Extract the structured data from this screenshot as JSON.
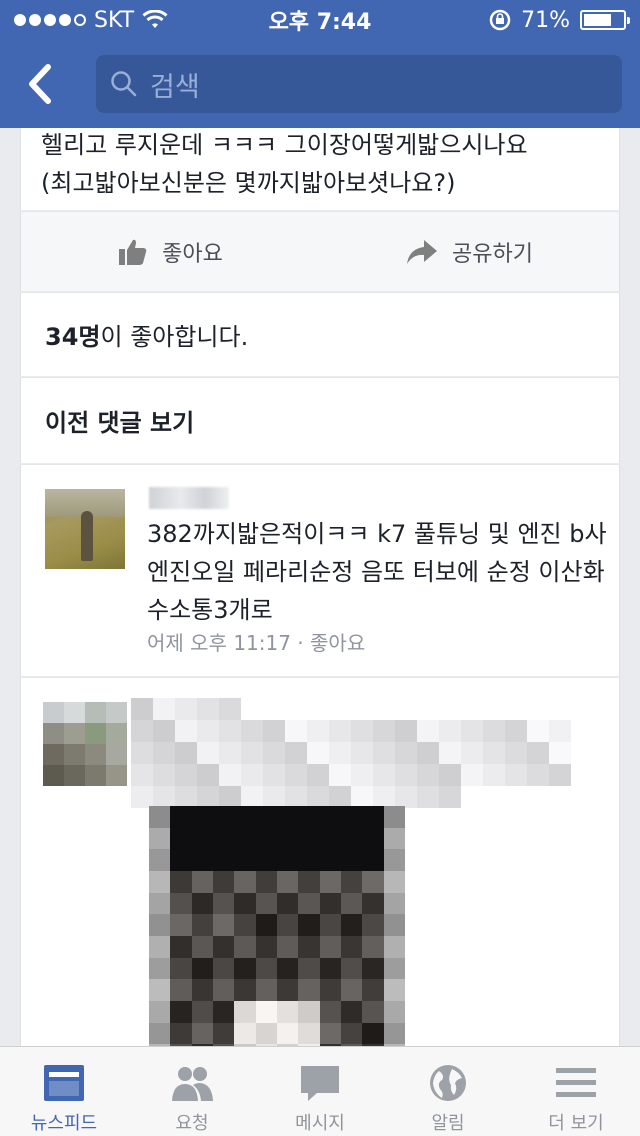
{
  "status_bar": {
    "carrier": "SKT",
    "time": "오후 7:44",
    "battery": "71%"
  },
  "search": {
    "placeholder": "검색"
  },
  "post": {
    "text_partial": "헬리고 루지운데 ㅋㅋㅋ 그이장어떻게밟으시나요",
    "text": "(최고밟아보신분은 몇까지밟아보셧나요?)"
  },
  "actions": {
    "like": "좋아요",
    "share": "공유하기"
  },
  "likes": {
    "count": "34명",
    "suffix": "이 좋아합니다."
  },
  "previous_comments": "이전 댓글 보기",
  "comments": [
    {
      "text": "382까지밟은적이ㅋㅋ k7 풀튜닝 및 엔진 b사 엔진오일 페라리순정 음또 터보에 순정 이산화수소통3개로",
      "time": "어제 오후 11:17",
      "separator": " · ",
      "like": "좋아요"
    }
  ],
  "tabbar": {
    "tabs": [
      {
        "label": "뉴스피드",
        "icon": "newsfeed-icon",
        "active": true
      },
      {
        "label": "요청",
        "icon": "friend-requests-icon"
      },
      {
        "label": "메시지",
        "icon": "messages-icon"
      },
      {
        "label": "알림",
        "icon": "notifications-globe-icon"
      },
      {
        "label": "더 보기",
        "icon": "more-menu-icon"
      }
    ]
  },
  "colors": {
    "brand": "#4267b2",
    "search_bg": "#365899"
  }
}
